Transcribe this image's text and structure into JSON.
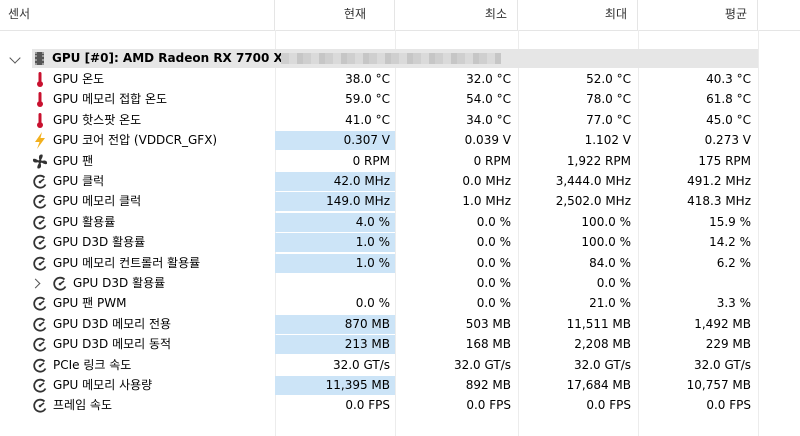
{
  "columns": {
    "sensor": "센서",
    "current": "현재",
    "min": "최소",
    "max": "최대",
    "avg": "평균"
  },
  "group": {
    "label": "GPU [#0]: AMD Radeon RX 7700 XT:"
  },
  "colors": {
    "selection": "#cce4f7",
    "thermometer": "#c8102e",
    "bolt": "#f2b01e",
    "icon": "#333333"
  },
  "rows": [
    {
      "icon": "thermometer-icon",
      "name": "GPU 온도",
      "current": "38.0 °C",
      "min": "32.0 °C",
      "max": "52.0 °C",
      "avg": "40.3 °C",
      "highlight": false
    },
    {
      "icon": "thermometer-icon",
      "name": "GPU 메모리 접합 온도",
      "current": "59.0 °C",
      "min": "54.0 °C",
      "max": "78.0 °C",
      "avg": "61.8 °C",
      "highlight": false
    },
    {
      "icon": "thermometer-icon",
      "name": "GPU 핫스팟 온도",
      "current": "41.0 °C",
      "min": "34.0 °C",
      "max": "77.0 °C",
      "avg": "45.0 °C",
      "highlight": false
    },
    {
      "icon": "bolt-icon",
      "name": "GPU 코어 전압 (VDDCR_GFX)",
      "current": "0.307 V",
      "min": "0.039 V",
      "max": "1.102 V",
      "avg": "0.273 V",
      "highlight": true
    },
    {
      "icon": "fan-icon",
      "name": "GPU 팬",
      "current": "0 RPM",
      "min": "0 RPM",
      "max": "1,922 RPM",
      "avg": "175 RPM",
      "highlight": false
    },
    {
      "icon": "gauge-icon",
      "name": "GPU 클럭",
      "current": "42.0 MHz",
      "min": "0.0 MHz",
      "max": "3,444.0 MHz",
      "avg": "491.2 MHz",
      "highlight": true
    },
    {
      "icon": "gauge-icon",
      "name": "GPU 메모리 클럭",
      "current": "149.0 MHz",
      "min": "1.0 MHz",
      "max": "2,502.0 MHz",
      "avg": "418.3 MHz",
      "highlight": true
    },
    {
      "icon": "gauge-icon",
      "name": "GPU 활용률",
      "current": "4.0 %",
      "min": "0.0 %",
      "max": "100.0 %",
      "avg": "15.9 %",
      "highlight": true
    },
    {
      "icon": "gauge-icon",
      "name": "GPU D3D 활용률",
      "current": "1.0 %",
      "min": "0.0 %",
      "max": "100.0 %",
      "avg": "14.2 %",
      "highlight": true
    },
    {
      "icon": "gauge-icon",
      "name": "GPU 메모리 컨트롤러 활용률",
      "current": "1.0 %",
      "min": "0.0 %",
      "max": "84.0 %",
      "avg": "6.2 %",
      "highlight": true
    },
    {
      "icon": "gauge-icon",
      "name": "GPU D3D 활용률",
      "current": "",
      "min": "0.0 %",
      "max": "0.0 %",
      "avg": "",
      "highlight": false,
      "sub": true
    },
    {
      "icon": "gauge-icon",
      "name": "GPU 팬 PWM",
      "current": "0.0 %",
      "min": "0.0 %",
      "max": "21.0 %",
      "avg": "3.3 %",
      "highlight": false
    },
    {
      "icon": "gauge-icon",
      "name": "GPU D3D 메모리 전용",
      "current": "870 MB",
      "min": "503 MB",
      "max": "11,511 MB",
      "avg": "1,492 MB",
      "highlight": true
    },
    {
      "icon": "gauge-icon",
      "name": "GPU D3D 메모리 동적",
      "current": "213 MB",
      "min": "168 MB",
      "max": "2,208 MB",
      "avg": "229 MB",
      "highlight": true
    },
    {
      "icon": "gauge-icon",
      "name": "PCIe 링크 속도",
      "current": "32.0 GT/s",
      "min": "32.0 GT/s",
      "max": "32.0 GT/s",
      "avg": "32.0 GT/s",
      "highlight": false
    },
    {
      "icon": "gauge-icon",
      "name": "GPU 메모리 사용량",
      "current": "11,395 MB",
      "min": "892 MB",
      "max": "17,684 MB",
      "avg": "10,757 MB",
      "highlight": true
    },
    {
      "icon": "gauge-icon",
      "name": "프레임 속도",
      "current": "0.0 FPS",
      "min": "0.0 FPS",
      "max": "0.0 FPS",
      "avg": "0.0 FPS",
      "highlight": false
    }
  ]
}
